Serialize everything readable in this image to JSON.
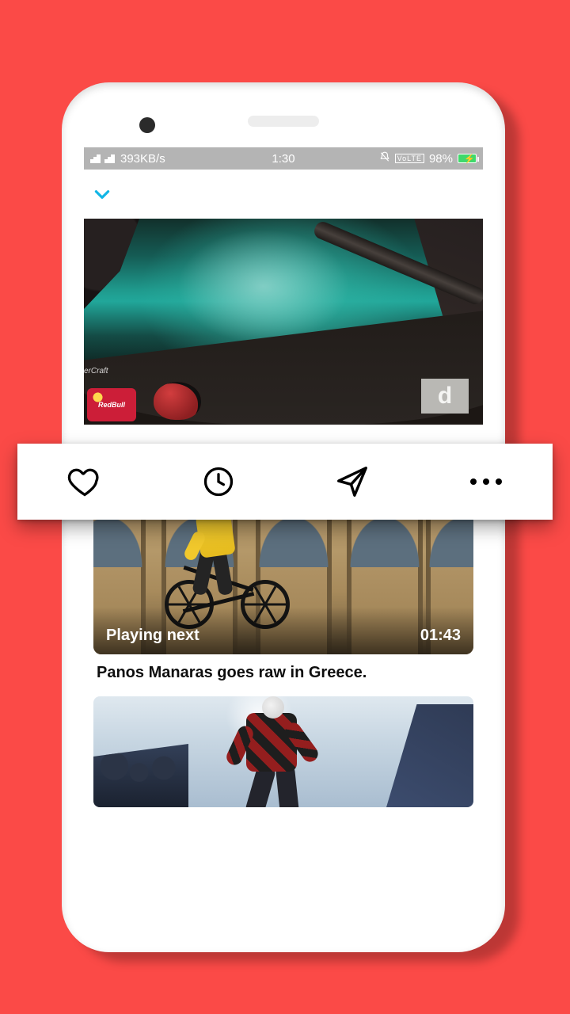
{
  "status_bar": {
    "network_speed": "393KB/s",
    "time": "1:30",
    "volte": "VoLTE",
    "battery_pct": "98%"
  },
  "main_video": {
    "sponsor_text": "RedBull",
    "logo_text_partial": "erCraft",
    "watermark_letter": "d"
  },
  "action_bar": {
    "like_name": "heart-icon",
    "watchlater_name": "clock-icon",
    "share_name": "send-icon",
    "more_name": "more-icon"
  },
  "playing_next": {
    "label": "Playing next",
    "duration": "01:43",
    "title": "Panos Manaras goes raw in Greece."
  }
}
